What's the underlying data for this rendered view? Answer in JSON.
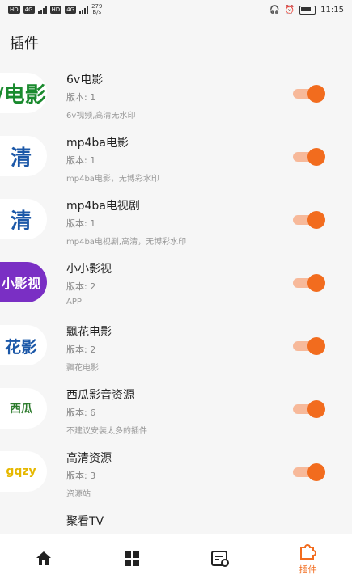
{
  "status_bar": {
    "left_badges": [
      "HD",
      "4G",
      "HD",
      "4G"
    ],
    "net_speed": "279",
    "net_unit": "B/s",
    "time": "11:15"
  },
  "page": {
    "title": "插件"
  },
  "plugins": [
    {
      "name": "6v电影",
      "version": "版本: 1",
      "desc": "6v视频,高清无水印",
      "logo_text": "/电影",
      "logo_color": "#1a8a2e",
      "enabled": true
    },
    {
      "name": "mp4ba电影",
      "version": "版本: 1",
      "desc": "mp4ba电影，无博彩水印",
      "logo_text": "清",
      "logo_color": "#1c58a8",
      "enabled": true
    },
    {
      "name": "mp4ba电视剧",
      "version": "版本: 1",
      "desc": "mp4ba电视剧,高清，无博彩水印",
      "logo_text": "清",
      "logo_color": "#1c58a8",
      "enabled": true
    },
    {
      "name": "小小影视",
      "version": "版本: 2",
      "desc": "APP",
      "logo_text": "小影视",
      "logo_color": "#7a2fc4",
      "enabled": true
    },
    {
      "name": "飘花电影",
      "version": "版本: 2",
      "desc": "飘花电影",
      "logo_text": "花影",
      "logo_color": "#1c58a8",
      "enabled": true
    },
    {
      "name": "西瓜影音资源",
      "version": "版本: 6",
      "desc": "不建议安装太多的插件",
      "logo_text": "西瓜",
      "logo_color": "#2b7a2b",
      "enabled": true
    },
    {
      "name": "高清资源",
      "version": "版本: 3",
      "desc": "资源站",
      "logo_text": "gqzy",
      "logo_color": "#e6b800",
      "enabled": true
    },
    {
      "name": "聚看TV",
      "version": "",
      "desc": "",
      "logo_text": "",
      "logo_color": "#ffffff",
      "enabled": true
    }
  ],
  "bottom_nav": [
    {
      "icon": "home-icon",
      "label": "",
      "active": false
    },
    {
      "icon": "grid-icon",
      "label": "",
      "active": false
    },
    {
      "icon": "history-icon",
      "label": "",
      "active": false
    },
    {
      "icon": "puzzle-icon",
      "label": "插件",
      "active": true
    }
  ],
  "colors": {
    "accent": "#f26c1e",
    "track": "#f7b99a"
  }
}
